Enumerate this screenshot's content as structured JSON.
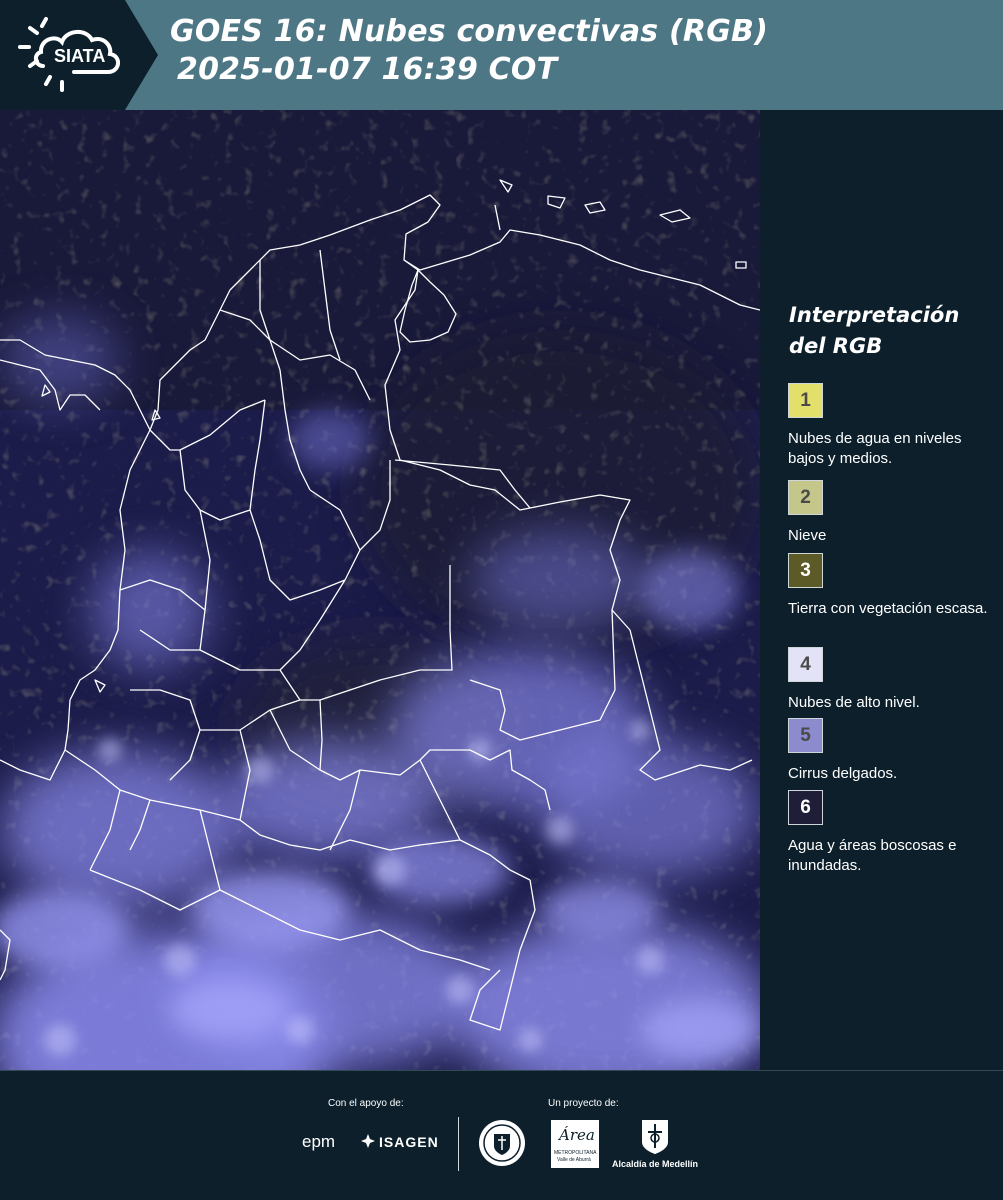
{
  "header": {
    "logo_text": "SIATA",
    "title_line1": "GOES 16: Nubes convectivas (RGB)",
    "title_line2": "2025-01-07 16:39 COT"
  },
  "legend": {
    "title_line1": "Interpretación",
    "title_line2": "del RGB",
    "items": [
      {
        "number": "1",
        "color": "#e2e06a",
        "label": "Nubes de agua en niveles bajos y medios."
      },
      {
        "number": "2",
        "color": "#c5c68a",
        "label": "Nieve"
      },
      {
        "number": "3",
        "color": "#5c5b27",
        "label": "Tierra con vegetación escasa."
      },
      {
        "number": "4",
        "color": "#e3e3f8",
        "label": "Nubes de alto nivel."
      },
      {
        "number": "5",
        "color": "#8b8bcd",
        "label": "Cirrus delgados."
      },
      {
        "number": "6",
        "color": "#1e1e38",
        "label": "Agua y áreas boscosas e inundadas."
      }
    ]
  },
  "footer": {
    "support_label": "Con el apoyo de:",
    "project_label": "Un proyecto de:",
    "logos": {
      "epm": "epm",
      "isagen": "ISAGEN",
      "metropolitana_main": "Área",
      "metropolitana_sub1": "METROPOLITANA",
      "metropolitana_sub2": "Valle de Aburrá",
      "alcaldia": "Alcaldía de Medellín"
    }
  },
  "colors": {
    "header_bg": "#4e7786",
    "logo_bg": "#0c1f2b",
    "page_bg": "#0c1f2b",
    "map_base": "#1c1c4a",
    "high_cloud": "#8c8cf0",
    "low_cloud": "#c8c46a",
    "border_line": "#ffffff"
  }
}
